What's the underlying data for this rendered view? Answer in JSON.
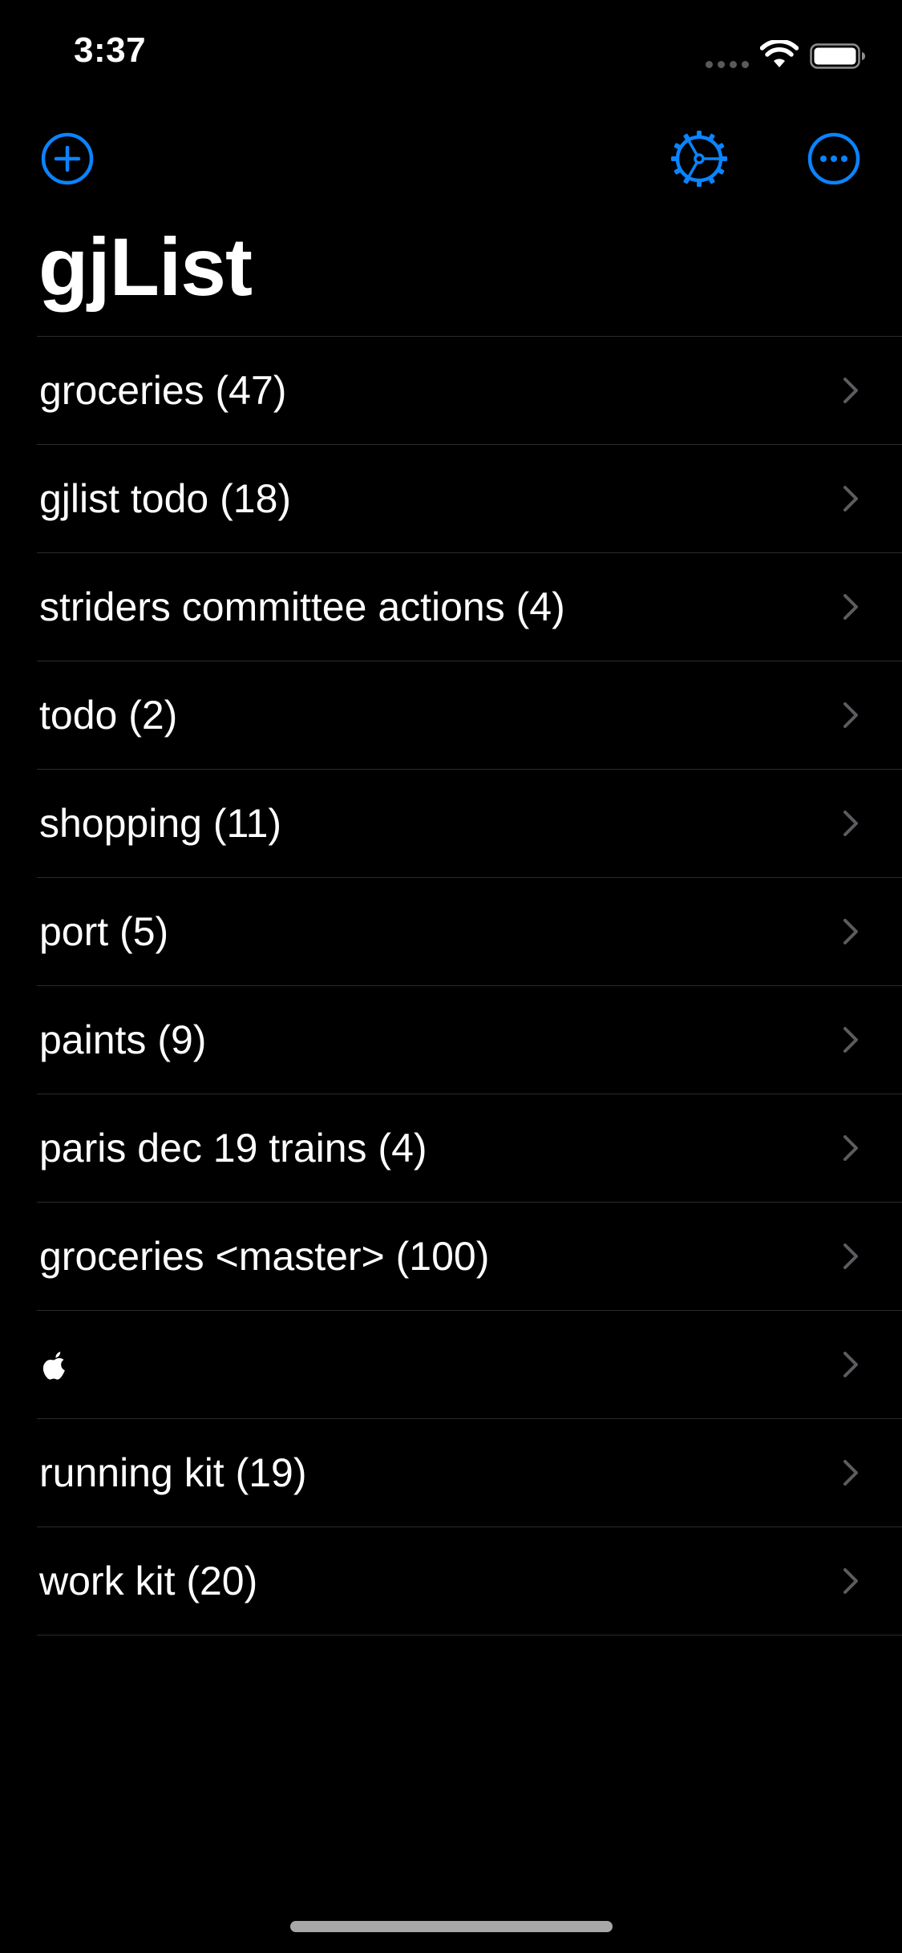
{
  "status_bar": {
    "time": "3:37"
  },
  "nav": {
    "add_icon": "plus-circle-icon",
    "settings_icon": "gear-icon",
    "more_icon": "ellipsis-circle-icon",
    "accent_color": "#0A84FF"
  },
  "title": "gjList",
  "lists": [
    {
      "label": "groceries (47)"
    },
    {
      "label": "gjlist todo (18)"
    },
    {
      "label": "striders committee actions (4)"
    },
    {
      "label": "todo (2)"
    },
    {
      "label": "shopping (11)"
    },
    {
      "label": "port (5)"
    },
    {
      "label": "paints (9)"
    },
    {
      "label": "paris dec 19 trains (4)"
    },
    {
      "label": "groceries <master> (100)"
    },
    {
      "label": "",
      "icon": "apple-logo-icon"
    },
    {
      "label": "running kit (19)"
    },
    {
      "label": "work kit (20)"
    }
  ],
  "colors": {
    "background": "#000000",
    "text": "#FFFFFF",
    "separator": "#2B2B2E",
    "chevron": "#5C5C60"
  }
}
